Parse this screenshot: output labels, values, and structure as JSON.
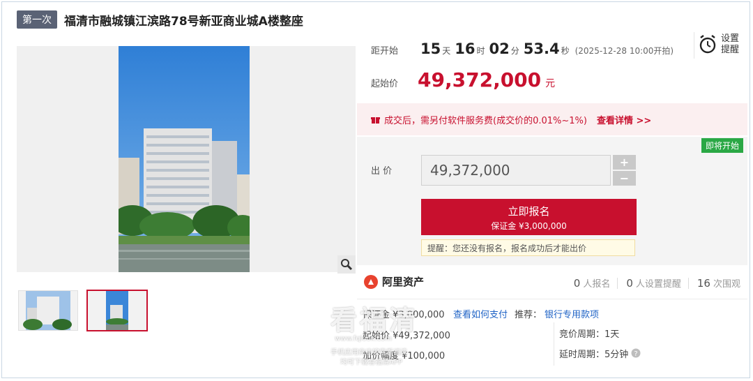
{
  "header": {
    "round_badge": "第一次",
    "title": "福清市融城镇江滨路78号新亚商业城A楼整座"
  },
  "countdown": {
    "label": "距开始",
    "days": "15",
    "days_unit": "天",
    "hours": "16",
    "hours_unit": "时",
    "minutes": "02",
    "minutes_unit": "分",
    "seconds": "53.4",
    "seconds_unit": "秒",
    "start_time": "(2025-12-28 10:00开拍)"
  },
  "reminder": {
    "label": "设置提醒"
  },
  "start_price": {
    "label": "起始价",
    "value": "49,372,000",
    "unit": "元"
  },
  "notice": {
    "text": "成交后，需另付软件服务费(成交价的0.01%~1%)",
    "link": "查看详情 >>"
  },
  "bid": {
    "status_tag": "即将开始",
    "label": "出 价",
    "input_value": "49,372,000",
    "plus": "+",
    "minus": "−",
    "apply_label": "立即报名",
    "deposit_label": "保证金 ¥3,000,000",
    "tip": "提醒：您还没有报名，报名成功后才能出价"
  },
  "platform": {
    "name": "阿里资产"
  },
  "stats": {
    "signups": "0",
    "signups_label": "人报名",
    "reminders": "0",
    "reminders_label": "人设置提醒",
    "views": "16",
    "views_label": "次围观"
  },
  "details": {
    "deposit": "保证金 ¥3,000,000",
    "how_to_pay": "查看如何支付",
    "recommend_label": "推荐：",
    "recommend_link": "银行专用款项",
    "start_price": "起始价 ¥49,372,000",
    "increment": "加价幅度 ¥100,000",
    "cycle": "竞价周期：1天",
    "delay": "延时周期：5分钟"
  },
  "watermark": {
    "big": "看福清",
    "line1": "www.fqlook.com",
    "line2": "手机应用商店搜索看福清",
    "line3": "均可下载看福清APP"
  }
}
